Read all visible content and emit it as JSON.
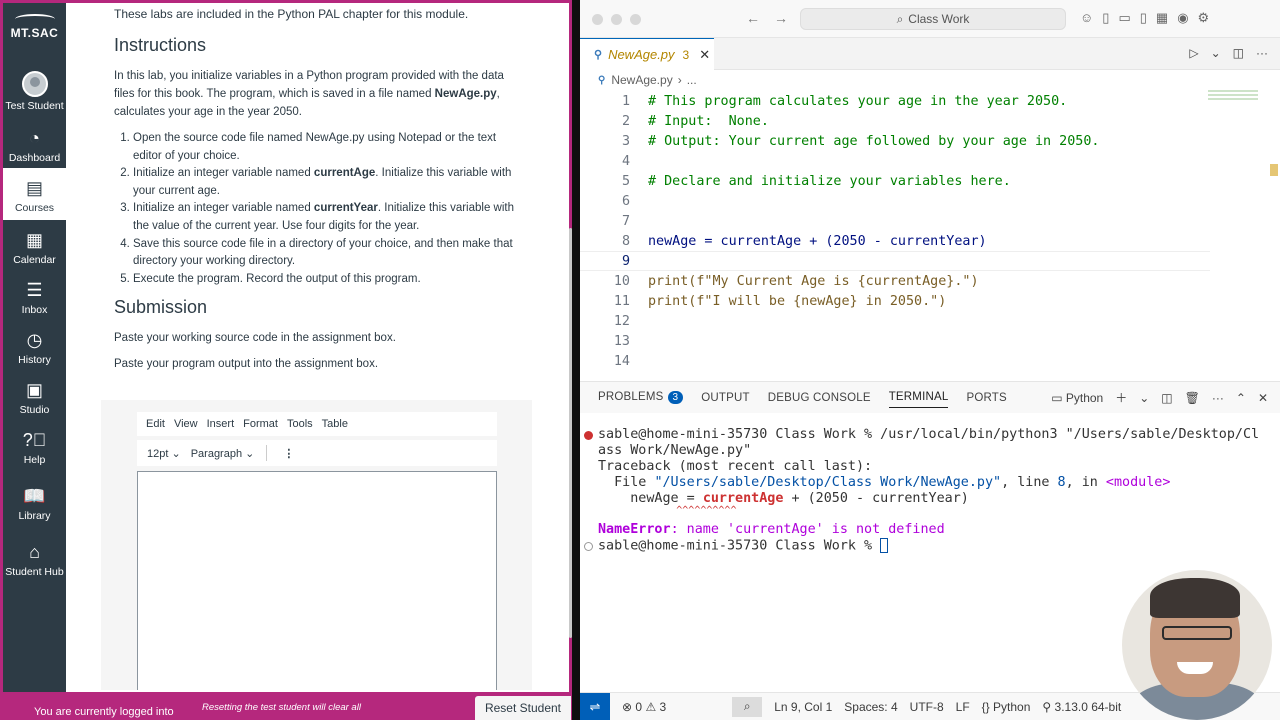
{
  "canvas": {
    "logo": "MT.SAC",
    "nav": [
      {
        "label": "Test Student",
        "icon": "avatar-icon"
      },
      {
        "label": "Dashboard",
        "icon": "dashboard-icon"
      },
      {
        "label": "Courses",
        "icon": "courses-icon"
      },
      {
        "label": "Calendar",
        "icon": "calendar-icon"
      },
      {
        "label": "Inbox",
        "icon": "inbox-icon"
      },
      {
        "label": "History",
        "icon": "history-icon"
      },
      {
        "label": "Studio",
        "icon": "studio-icon"
      },
      {
        "label": "Help",
        "icon": "help-icon"
      },
      {
        "label": "Library",
        "icon": "library-icon"
      },
      {
        "label": "Student Hub",
        "icon": "student-hub-icon"
      }
    ],
    "intro": "These labs are included in the Python PAL chapter for this module.",
    "instructions_heading": "Instructions",
    "para_before": "In this lab, you initialize variables in a Python program provided with the data files for this book. The program, which is saved in a file named ",
    "para_file": "NewAge.py",
    "para_after": ", calculates your age in the year 2050.",
    "steps": [
      {
        "pre": "Open the source code file named NewAge.py using Notepad or the text editor of your choice.",
        "bold": "",
        "post": ""
      },
      {
        "pre": "Initialize an integer variable named ",
        "bold": "currentAge",
        "post": ". Initialize this variable with your current age."
      },
      {
        "pre": "Initialize an integer variable named ",
        "bold": "currentYear",
        "post": ". Initialize this variable with the value of the current year. Use four digits for the year."
      },
      {
        "pre": "Save this source code file in a directory of your choice, and then make that directory your working directory.",
        "bold": "",
        "post": ""
      },
      {
        "pre": "Execute the program. Record the output of this program.",
        "bold": "",
        "post": ""
      }
    ],
    "submission_heading": "Submission",
    "submission_p1": "Paste your working source code in the assignment box.",
    "submission_p2": "Paste your program output into the assignment box.",
    "editor_menu": [
      "Edit",
      "View",
      "Insert",
      "Format",
      "Tools",
      "Table"
    ],
    "font_size": "12pt",
    "block_format": "Paragraph",
    "bottom_msg1": "You are currently logged into",
    "bottom_msg2": "Resetting the test student will clear all",
    "reset_button": "Reset Student",
    "accent": "#b5287d"
  },
  "vscode": {
    "search": "Class Work",
    "tab_name": "NewAge.py",
    "tab_problem_count": "3",
    "breadcrumb_file": "NewAge.py",
    "breadcrumb_more": "...",
    "code_lines": [
      {
        "n": "1",
        "text": "# This program calculates your age in the year 2050."
      },
      {
        "n": "2",
        "text": "# Input:  None."
      },
      {
        "n": "3",
        "text": "# Output: Your current age followed by your age in 2050."
      },
      {
        "n": "4",
        "text": ""
      },
      {
        "n": "5",
        "text": "# Declare and initialize your variables here."
      },
      {
        "n": "6",
        "text": ""
      },
      {
        "n": "7",
        "text": ""
      },
      {
        "n": "8",
        "text": "newAge = currentAge + (2050 - currentYear)"
      },
      {
        "n": "9",
        "text": ""
      },
      {
        "n": "10",
        "text": "print(f\"My Current Age is {currentAge}.\")"
      },
      {
        "n": "11",
        "text": "print(f\"I will be {newAge} in 2050.\")"
      },
      {
        "n": "12",
        "text": ""
      },
      {
        "n": "13",
        "text": ""
      },
      {
        "n": "14",
        "text": ""
      }
    ],
    "panel_tabs": [
      "PROBLEMS",
      "OUTPUT",
      "DEBUG CONSOLE",
      "TERMINAL",
      "PORTS"
    ],
    "problems_badge": "3",
    "terminal_profile": "Python",
    "terminal": {
      "prompt1": "sable@home-mini-35730 Class Work % /usr/local/bin/python3 \"/Users/sable/Desktop/Cl",
      "prompt1b": "ass Work/NewAge.py\"",
      "traceback": "Traceback (most recent call last):",
      "file_pre": "  File ",
      "file_path": "\"/Users/sable/Desktop/Class Work/NewAge.py\"",
      "file_mid": ", line ",
      "file_line": "8",
      "file_in": ", in ",
      "file_mod": "<module>",
      "code_pre": "    newAge = ",
      "code_err": "currentAge",
      "code_post": " + (2050 - currentYear)",
      "carets": "             ^^^^^^^^^^",
      "error_name": "NameError",
      "error_msg": ": name 'currentAge' is not defined",
      "prompt2": "sable@home-mini-35730 Class Work % "
    },
    "status": {
      "errors": "0",
      "warnings": "3",
      "position": "Ln 9, Col 1",
      "spaces": "Spaces: 4",
      "encoding": "UTF-8",
      "eol": "LF",
      "language": "Python",
      "interpreter": "3.13.0 64-bit"
    },
    "accent": "#005fb8"
  }
}
